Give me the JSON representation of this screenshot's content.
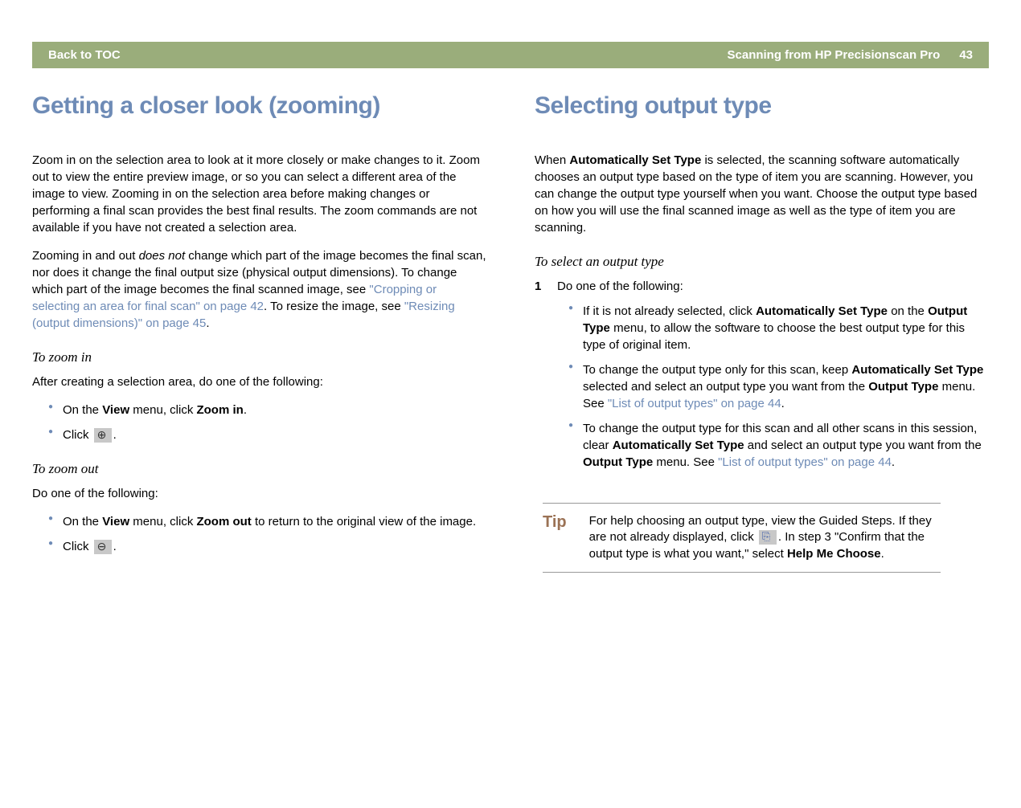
{
  "header": {
    "back": "Back to TOC",
    "section": "Scanning from HP Precisionscan Pro",
    "page": "43"
  },
  "left": {
    "title": "Getting a closer look (zooming)",
    "para1": "Zoom in on the selection area to look at it more closely or make changes to it. Zoom out to view the entire preview image, or so you can select a different area of the image to view. Zooming in on the selection area before making changes or performing a final scan provides the best final results. The zoom commands are not available if you have not created a selection area.",
    "para2a": "Zooming in and out ",
    "para2_em": "does not",
    "para2b": " change which part of the image becomes the final scan, nor does it change the final output size (physical output dimensions). To change which part of the image becomes the final scanned image, see ",
    "link1": "\"Cropping or selecting an area for final scan\" on page 42",
    "para2c": ". To resize the image, see ",
    "link2": "\"Resizing (output dimensions)\" on page 45",
    "para2d": ".",
    "zoom_in_heading": "To zoom in",
    "zoom_in_intro": "After creating a selection area, do one of the following:",
    "zoom_in_item1a": "On the ",
    "zoom_in_item1b": "View",
    "zoom_in_item1c": " menu, click ",
    "zoom_in_item1d": "Zoom in",
    "zoom_in_item1e": ".",
    "zoom_in_item2a": "Click ",
    "zoom_in_item2b": ".",
    "zoom_out_heading": "To zoom out",
    "zoom_out_intro": "Do one of the following:",
    "zoom_out_item1a": "On the ",
    "zoom_out_item1b": "View",
    "zoom_out_item1c": " menu, click ",
    "zoom_out_item1d": "Zoom out",
    "zoom_out_item1e": " to return to the original view of the image.",
    "zoom_out_item2a": "Click ",
    "zoom_out_item2b": "."
  },
  "right": {
    "title": "Selecting output type",
    "para1a": "When ",
    "para1b": "Automatically Set Type",
    "para1c": " is selected, the scanning software automatically chooses an output type based on the type of item you are scanning. However, you can change the output type yourself when you want. Choose the output type based on how you will use the final scanned image as well as the type of item you are scanning.",
    "select_heading": "To select an output type",
    "step1_num": "1",
    "step1_text": "Do one of the following:",
    "bullet1a": "If it is not already selected, click ",
    "bullet1b": "Automatically Set Type",
    "bullet1c": " on the ",
    "bullet1d": "Output Type",
    "bullet1e": " menu, to allow the software to choose the best output type for this type of original item.",
    "bullet2a": "To change the output type only for this scan, keep ",
    "bullet2b": "Automatically Set Type",
    "bullet2c": " selected and select an output type you want from the ",
    "bullet2d": "Output Type",
    "bullet2e": " menu. See ",
    "bullet2link": "\"List of output types\" on page 44",
    "bullet2f": ".",
    "bullet3a": "To change the output type for this scan and all other scans in this session, clear ",
    "bullet3b": "Automatically Set Type",
    "bullet3c": " and select an output type you want from the ",
    "bullet3d": "Output Type",
    "bullet3e": " menu. See ",
    "bullet3link": "\"List of output types\" on page 44",
    "bullet3f": ".",
    "tip_label": "Tip",
    "tip_a": "For help choosing an output type, view the Guided Steps. If they are not already displayed, click ",
    "tip_b": ". In step 3 \"Confirm that the output type is what you want,\" select ",
    "tip_c": "Help Me Choose",
    "tip_d": "."
  }
}
